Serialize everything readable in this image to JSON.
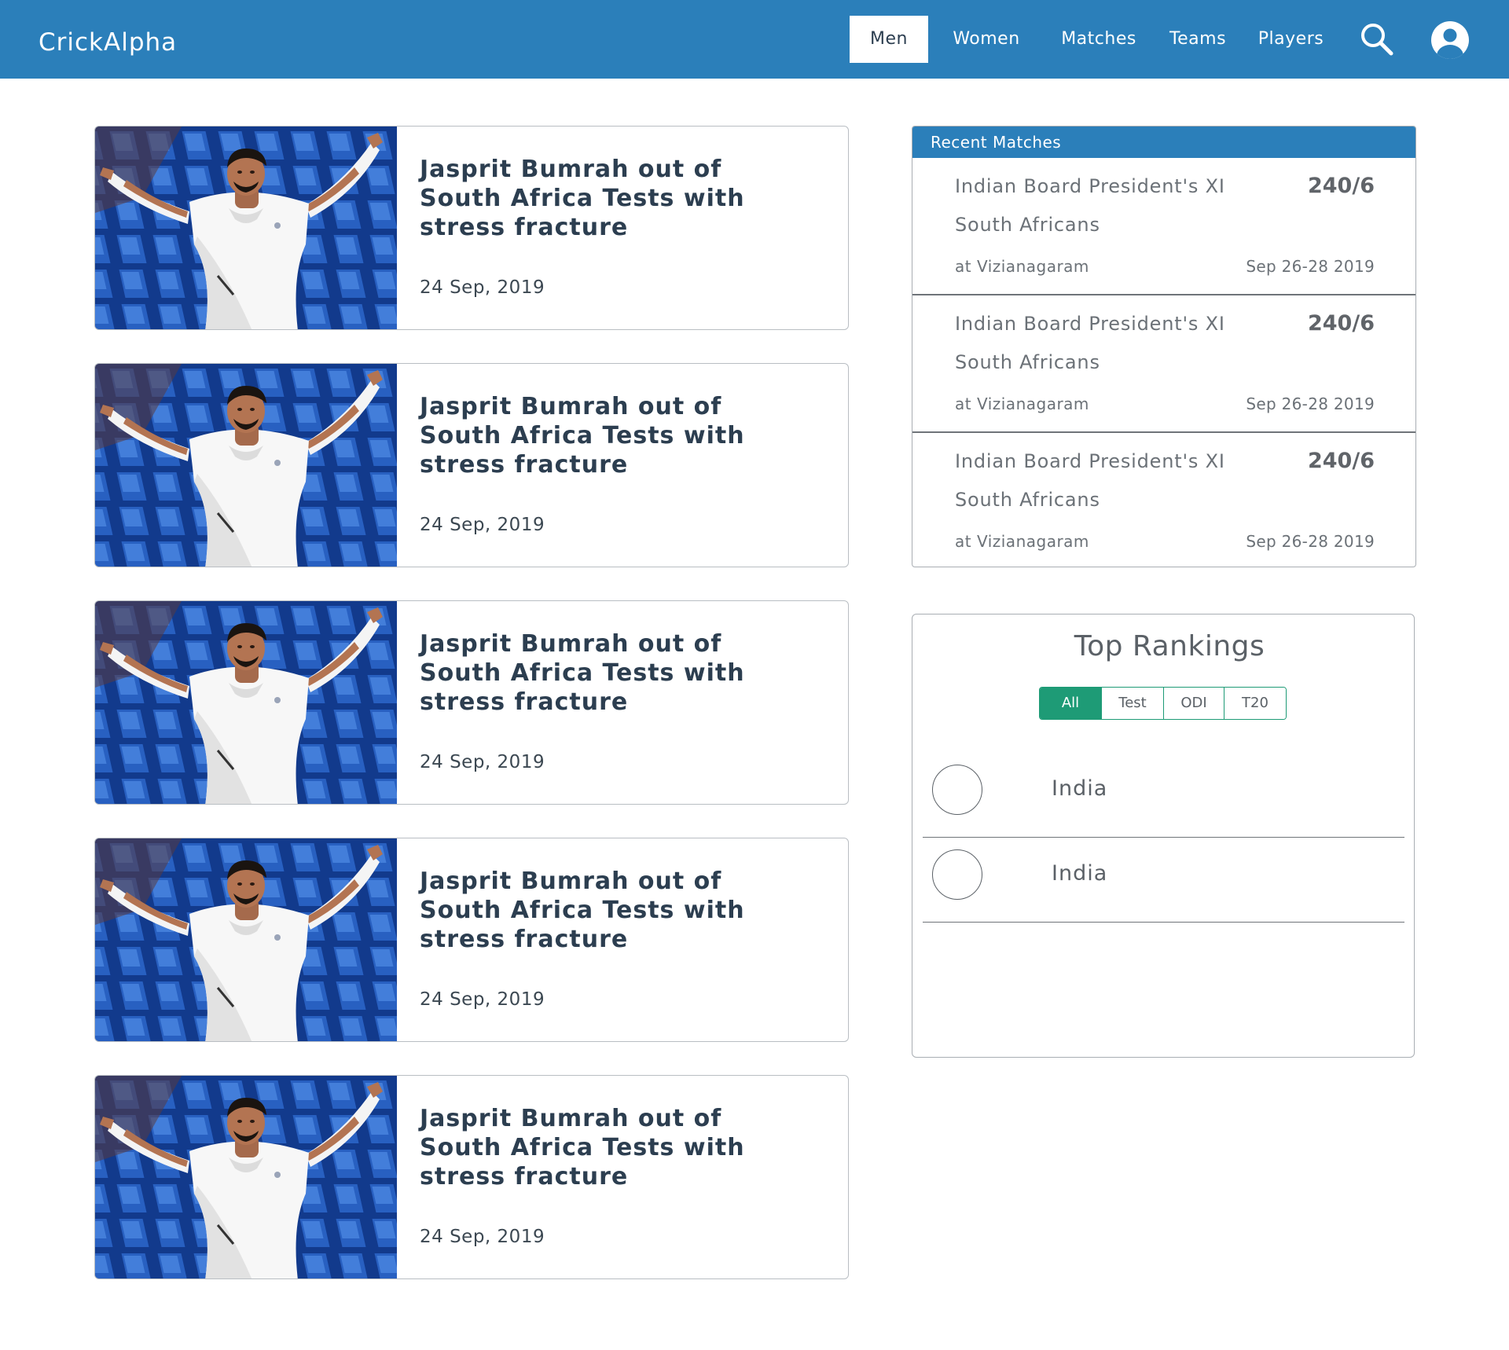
{
  "navbar": {
    "brand": "CrickAlpha",
    "links": [
      "Men",
      "Women",
      "Matches",
      "Teams",
      "Players"
    ],
    "active": "Men"
  },
  "news": [
    {
      "title": "Jasprit Bumrah out of South Africa Tests with stress fracture",
      "date": "24 Sep, 2019"
    },
    {
      "title": "Jasprit Bumrah out of South Africa Tests with stress fracture",
      "date": "24 Sep, 2019"
    },
    {
      "title": "Jasprit Bumrah out of South Africa Tests with stress fracture",
      "date": "24 Sep, 2019"
    },
    {
      "title": "Jasprit Bumrah out of South Africa Tests with stress fracture",
      "date": "24 Sep, 2019"
    },
    {
      "title": "Jasprit Bumrah out of South Africa Tests with stress fracture",
      "date": "24 Sep, 2019"
    }
  ],
  "recent_matches": {
    "header": "Recent Matches",
    "items": [
      {
        "team1": "Indian Board President's XI",
        "team2": "South Africans",
        "score": "240/6",
        "venue": "at Vizianagaram",
        "dates": "Sep 26-28 2019"
      },
      {
        "team1": "Indian Board President's XI",
        "team2": "South Africans",
        "score": "240/6",
        "venue": "at Vizianagaram",
        "dates": "Sep 26-28 2019"
      },
      {
        "team1": "Indian Board President's XI",
        "team2": "South Africans",
        "score": "240/6",
        "venue": "at Vizianagaram",
        "dates": "Sep 26-28 2019"
      }
    ]
  },
  "rankings": {
    "title": "Top Rankings",
    "tabs": [
      "All",
      "Test",
      "ODI",
      "T20"
    ],
    "active_tab": "All",
    "rows": [
      {
        "team": "India"
      },
      {
        "team": "India"
      }
    ]
  },
  "colors": {
    "navbar": "#2b7fba",
    "accent_green": "#1e9b76",
    "text_dark": "#2c3e50",
    "text_muted": "#6b7177"
  },
  "icons": {
    "search": "search-icon",
    "profile": "user-avatar-icon",
    "news_image": "cricket-player-photo"
  }
}
